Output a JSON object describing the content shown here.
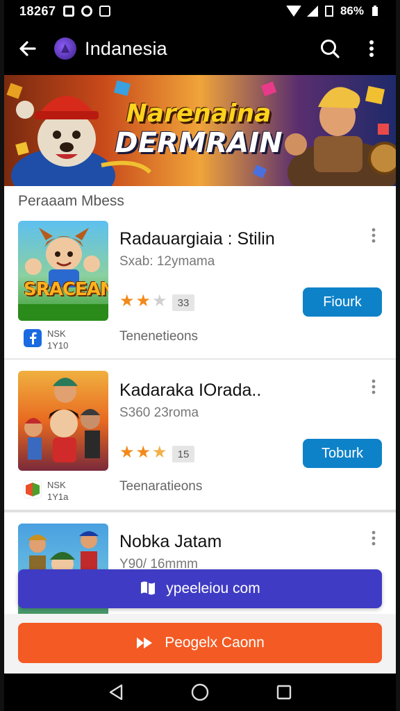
{
  "status_bar": {
    "time": "18267",
    "battery": "86%"
  },
  "app_bar": {
    "title": "Indanesia"
  },
  "banner": {
    "line1": "Narenaina",
    "line2": "DERMRAIN"
  },
  "section": {
    "title": "Peraaam  Mbess"
  },
  "games": [
    {
      "title": "Radauargiaia  :  Stilin",
      "subtitle": "Sxab: 12ymama",
      "stars": "★★★",
      "rating_count": "33",
      "button_label": "Fiourk",
      "publisher_line1": "NSK",
      "publisher_line2": "1Y10",
      "tags": "Tenenetieons",
      "thumb_caption": "SRACEAN"
    },
    {
      "title": "Kadaraka IOrada..",
      "subtitle": "S360 23roma",
      "stars": "★★★",
      "rating_count": "15",
      "button_label": "Toburk",
      "publisher_line1": "NSK",
      "publisher_line2": "1Y1a",
      "tags": "Teenaratieons"
    },
    {
      "title": "Nobka Jatam",
      "subtitle": "Y90/ 16mmm"
    }
  ],
  "cta": {
    "primary_label": "ypeeleiou com",
    "secondary_label": "Peogelx Caonn"
  },
  "colors": {
    "accent_blue": "#0e82c8",
    "primary_cta": "#3f3bc4",
    "secondary_cta": "#f45a23",
    "star": "#f28a1a"
  }
}
